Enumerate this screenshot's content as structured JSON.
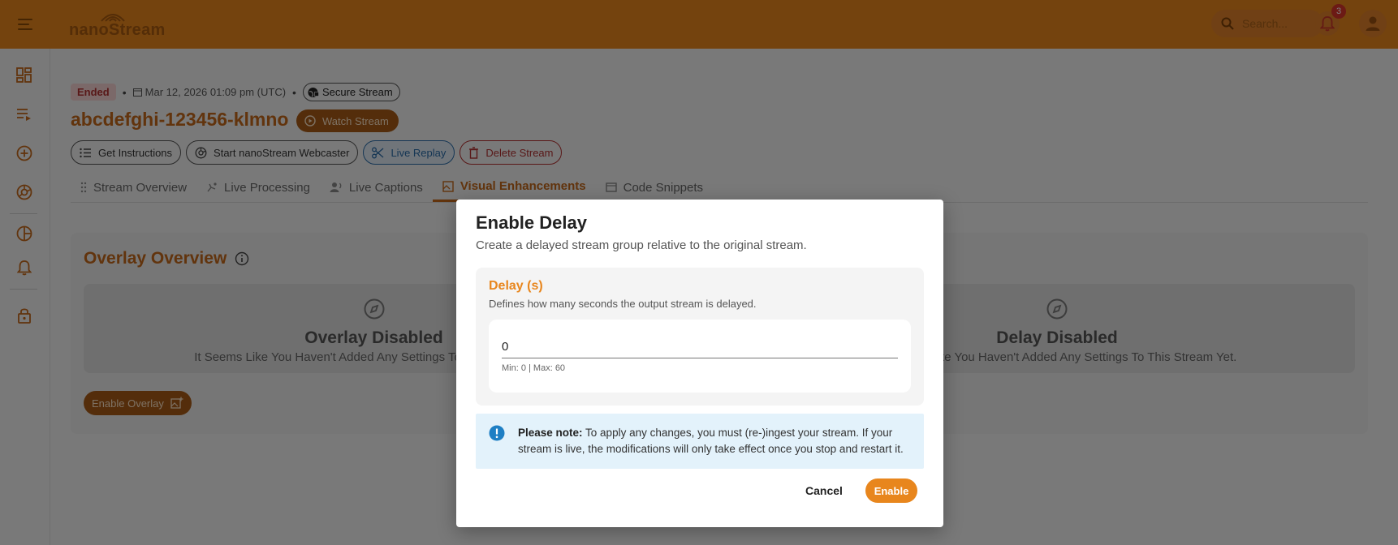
{
  "app": {
    "logo_text": "nanoStream",
    "search_placeholder": "Search...",
    "notification_count": "3",
    "accent_color": "#e8861d"
  },
  "sidebar": {
    "items": [
      {
        "name": "dashboard-icon"
      },
      {
        "name": "streams-list-icon"
      },
      {
        "name": "add-stream-icon"
      },
      {
        "name": "webcaster-icon"
      },
      {
        "name": "analytics-icon"
      },
      {
        "name": "alerts-icon"
      },
      {
        "name": "security-icon"
      }
    ]
  },
  "stream": {
    "status": "Ended",
    "date": "Mar 12, 2026 01:09 pm (UTC)",
    "secure_label": "Secure Stream",
    "title": "abcdefghi-123456-klmno",
    "watch_label": "Watch Stream"
  },
  "actions": {
    "instructions": "Get Instructions",
    "webcaster": "Start nanoStream Webcaster",
    "replay": "Live Replay",
    "delete": "Delete Stream"
  },
  "tabs": [
    {
      "label": "Stream Overview"
    },
    {
      "label": "Live Processing"
    },
    {
      "label": "Live Captions"
    },
    {
      "label": "Visual Enhancements"
    },
    {
      "label": "Code Snippets"
    }
  ],
  "panel": {
    "title": "Overlay Overview",
    "overlay_card": {
      "title": "Overlay Disabled",
      "subtitle": "It Seems Like You Haven't Added Any Settings To This Stream Yet."
    },
    "delay_card": {
      "title": "Delay Disabled",
      "subtitle": "It Seems Like You Haven't Added Any Settings To This Stream Yet."
    },
    "enable_overlay": "Enable Overlay"
  },
  "modal": {
    "title": "Enable Delay",
    "description": "Create a delayed stream group relative to the original stream.",
    "field_label": "Delay (s)",
    "field_description": "Defines how many seconds the output stream is delayed.",
    "value": "0",
    "helper": "Min: 0 | Max: 60",
    "note_bold": "Please note:",
    "note_text": " To apply any changes, you must (re-)ingest your stream. If your stream is live, the modifications will only take effect once you stop and restart it.",
    "cancel": "Cancel",
    "enable": "Enable"
  }
}
